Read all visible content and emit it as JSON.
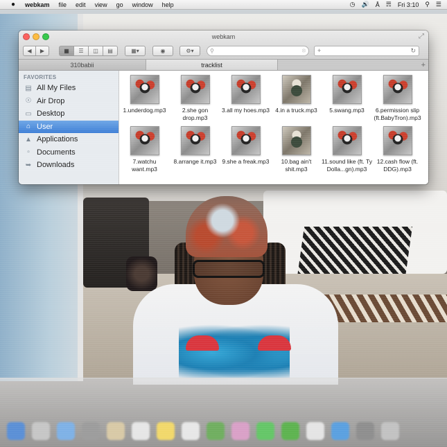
{
  "menubar": {
    "app_name": "webkam",
    "items": [
      "file",
      "edit",
      "view",
      "go",
      "window",
      "help"
    ],
    "clock": "Fri 3:10"
  },
  "window": {
    "title": "webkam",
    "search_placeholder": "",
    "tabs": [
      {
        "label": "310babii",
        "active": false
      },
      {
        "label": "tracklist",
        "active": true
      }
    ],
    "sidebar": {
      "heading": "FAVORITES",
      "items": [
        {
          "label": "All My Files",
          "icon": "all-files-icon",
          "selected": false
        },
        {
          "label": "Air Drop",
          "icon": "airdrop-icon",
          "selected": false
        },
        {
          "label": "Desktop",
          "icon": "desktop-icon",
          "selected": false
        },
        {
          "label": "User",
          "icon": "home-icon",
          "selected": true
        },
        {
          "label": "Applications",
          "icon": "applications-icon",
          "selected": false
        },
        {
          "label": "Documents",
          "icon": "documents-icon",
          "selected": false
        },
        {
          "label": "Downloads",
          "icon": "downloads-icon",
          "selected": false
        }
      ]
    },
    "files": [
      {
        "name": "1.underdog.mp3"
      },
      {
        "name": "2.she gon drop.mp3"
      },
      {
        "name": "3.all my hoes.mp3"
      },
      {
        "name": "4.in a truck.mp3"
      },
      {
        "name": "5.swang.mp3"
      },
      {
        "name": "6.permission slip (ft.BabyTron).mp3"
      },
      {
        "name": "7.watchu want.mp3"
      },
      {
        "name": "8.arrange it.mp3"
      },
      {
        "name": "9.she a freak.mp3"
      },
      {
        "name": "10.bag ain't shit.mp3"
      },
      {
        "name": "11.sound like (ft. Ty Dolla...gn).mp3"
      },
      {
        "name": "12.cash flow (ft. DDG).mp3"
      }
    ]
  },
  "colors": {
    "selection": "#3e7fd6",
    "close": "#fc605c",
    "minimize": "#fdbc40",
    "maximize": "#34c84a"
  }
}
